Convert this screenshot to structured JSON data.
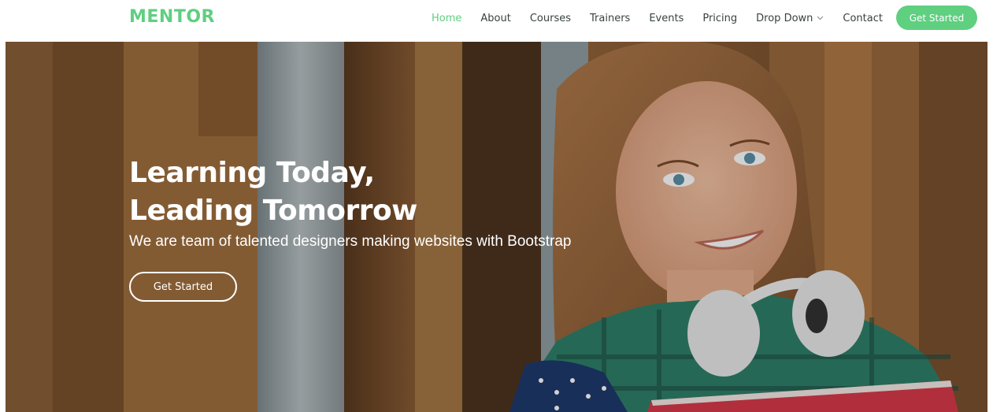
{
  "brand": {
    "logo": "MENTOR",
    "accent": "#5fcf80"
  },
  "nav": {
    "items": [
      "Home",
      "About",
      "Courses",
      "Trainers",
      "Events",
      "Pricing",
      "Drop Down",
      "Contact"
    ],
    "active": "Home",
    "dropdown_icon": "chevron-down-icon",
    "cta": "Get Started"
  },
  "hero": {
    "title_line1": "Learning Today,",
    "title_line2": "Leading Tomorrow",
    "subtitle": "We are team of talented designers making websites with Bootstrap",
    "button": "Get Started"
  }
}
